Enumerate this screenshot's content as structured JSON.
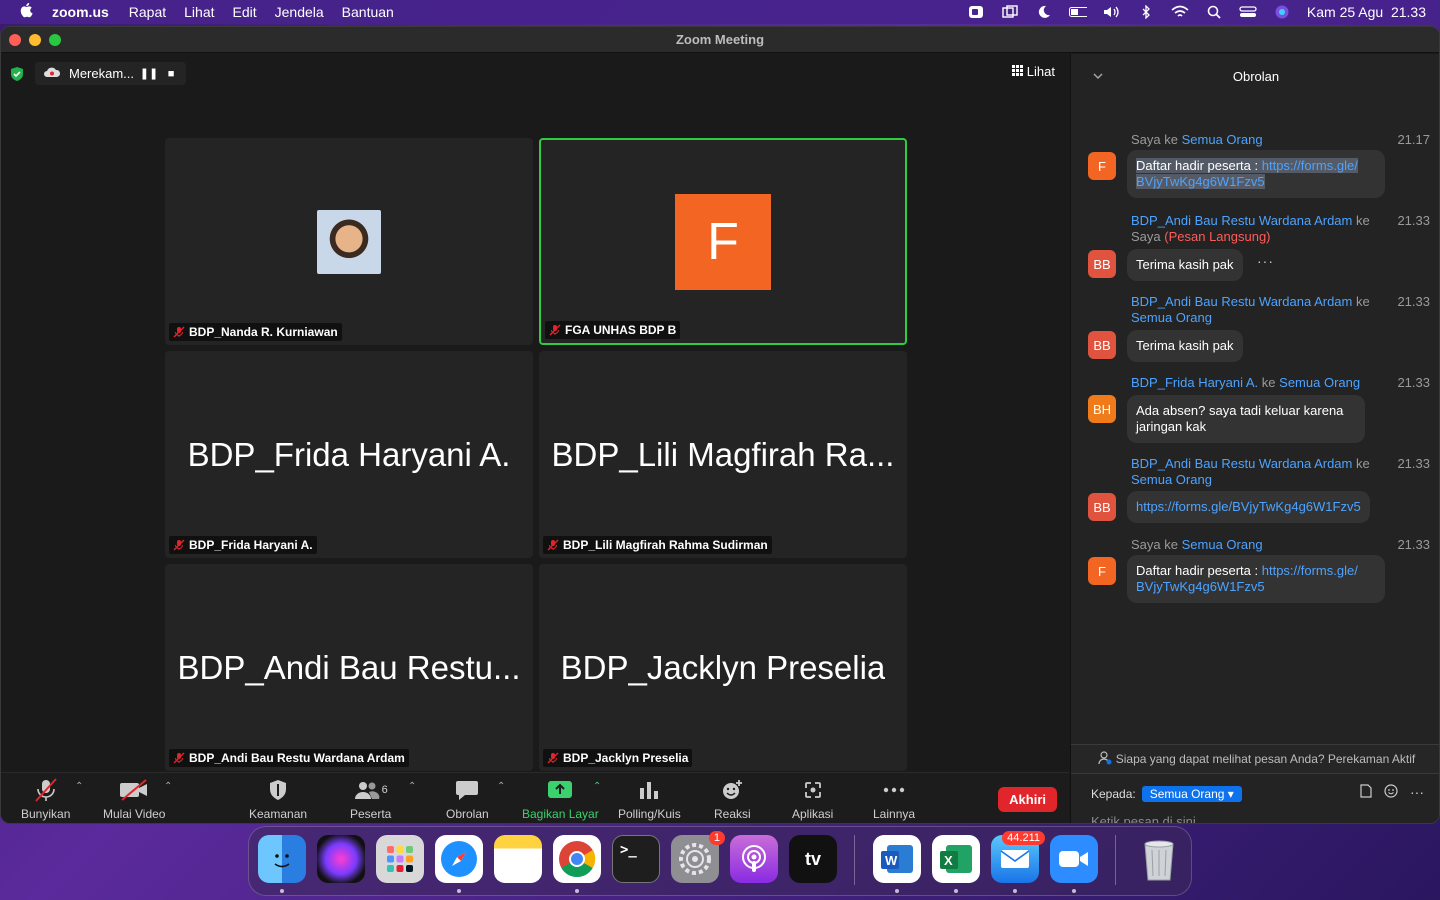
{
  "menubar": {
    "app_name": "zoom.us",
    "menus": [
      "Rapat",
      "Lihat",
      "Edit",
      "Jendela",
      "Bantuan"
    ],
    "clock": "Kam 25 Agu  21.33"
  },
  "window": {
    "title": "Zoom Meeting"
  },
  "recording": {
    "label": "Merekam..."
  },
  "view_button": {
    "label": "Lihat"
  },
  "tiles": [
    {
      "big_name": "",
      "label": "BDP_Nanda R. Kurniawan",
      "kind": "photo"
    },
    {
      "big_name": "F",
      "label": "FGA UNHAS BDP B",
      "kind": "avatar",
      "active": true
    },
    {
      "big_name": "BDP_Frida Haryani A.",
      "label": "BDP_Frida Haryani A.",
      "kind": "name"
    },
    {
      "big_name": "BDP_Lili Magfirah Ra...",
      "label": "BDP_Lili Magfirah Rahma Sudirman",
      "kind": "name"
    },
    {
      "big_name": "BDP_Andi Bau Restu...",
      "label": "BDP_Andi Bau Restu Wardana Ardam",
      "kind": "name"
    },
    {
      "big_name": "BDP_Jacklyn Preselia",
      "label": "BDP_Jacklyn Preselia",
      "kind": "name"
    }
  ],
  "toolbar": {
    "unmute": "Bunyikan",
    "video": "Mulai Video",
    "security": "Keamanan",
    "participants": "Peserta",
    "participants_count": "6",
    "chat": "Obrolan",
    "share": "Bagikan Layar",
    "polling": "Polling/Kuis",
    "reactions": "Reaksi",
    "apps": "Aplikasi",
    "more": "Lainnya",
    "end": "Akhiri"
  },
  "chat": {
    "title": "Obrolan",
    "messages": [
      {
        "from": "Saya",
        "to_word": "ke",
        "to": "Semua Orang",
        "time": "21.17",
        "avatar": "F",
        "text": "Daftar hadir peserta : ",
        "link1": "https://forms.gle/",
        "link2": "BVjyTwKg4g6W1Fzv5"
      },
      {
        "from": "BDP_Andi Bau Restu Wardana Ardam",
        "to_word": "ke",
        "to": "Saya",
        "direct": "(Pesan Langsung)",
        "time": "21.33",
        "avatar": "BB",
        "text": "Terima kasih pak"
      },
      {
        "from": "BDP_Andi Bau Restu Wardana Ardam",
        "to_word": "ke",
        "to": "Semua Orang",
        "time": "21.33",
        "avatar": "BB",
        "text": "Terima kasih pak"
      },
      {
        "from": "BDP_Frida Haryani A.",
        "to_word": "ke",
        "to": "Semua Orang",
        "time": "21.33",
        "avatar": "BH",
        "text": "Ada absen? saya tadi keluar karena jaringan kak"
      },
      {
        "from": "BDP_Andi Bau Restu Wardana Ardam",
        "to_word": "ke",
        "to": "Semua Orang",
        "time": "21.33",
        "avatar": "BB",
        "text": "https://forms.gle/BVjyTwKg4g6W1Fzv5"
      },
      {
        "from": "Saya",
        "to_word": "ke",
        "to": "Semua Orang",
        "time": "21.33",
        "avatar": "F",
        "text": "Daftar hadir peserta : ",
        "link1": "https://forms.gle/",
        "link2": "BVjyTwKg4g6W1Fzv5"
      }
    ],
    "notice": "Siapa yang dapat melihat pesan Anda? Perekaman Aktif",
    "to_label": "Kepada:",
    "to_value": "Semua Orang",
    "placeholder": "Ketik pesan di sini..."
  },
  "dock": {
    "settings_badge": "1",
    "mail_badge": "44.211",
    "apps": [
      "finder",
      "siri",
      "launchpad",
      "safari",
      "notes",
      "chrome",
      "terminal",
      "settings",
      "podcasts",
      "tv",
      "word",
      "excel",
      "mail",
      "zoom",
      "trash"
    ],
    "tv_label": "tv"
  },
  "colors": {
    "accent_blue": "#0e72ed",
    "end_red": "#e0262b",
    "active_green": "#2ecc40",
    "avatar_orange": "#f26522"
  }
}
